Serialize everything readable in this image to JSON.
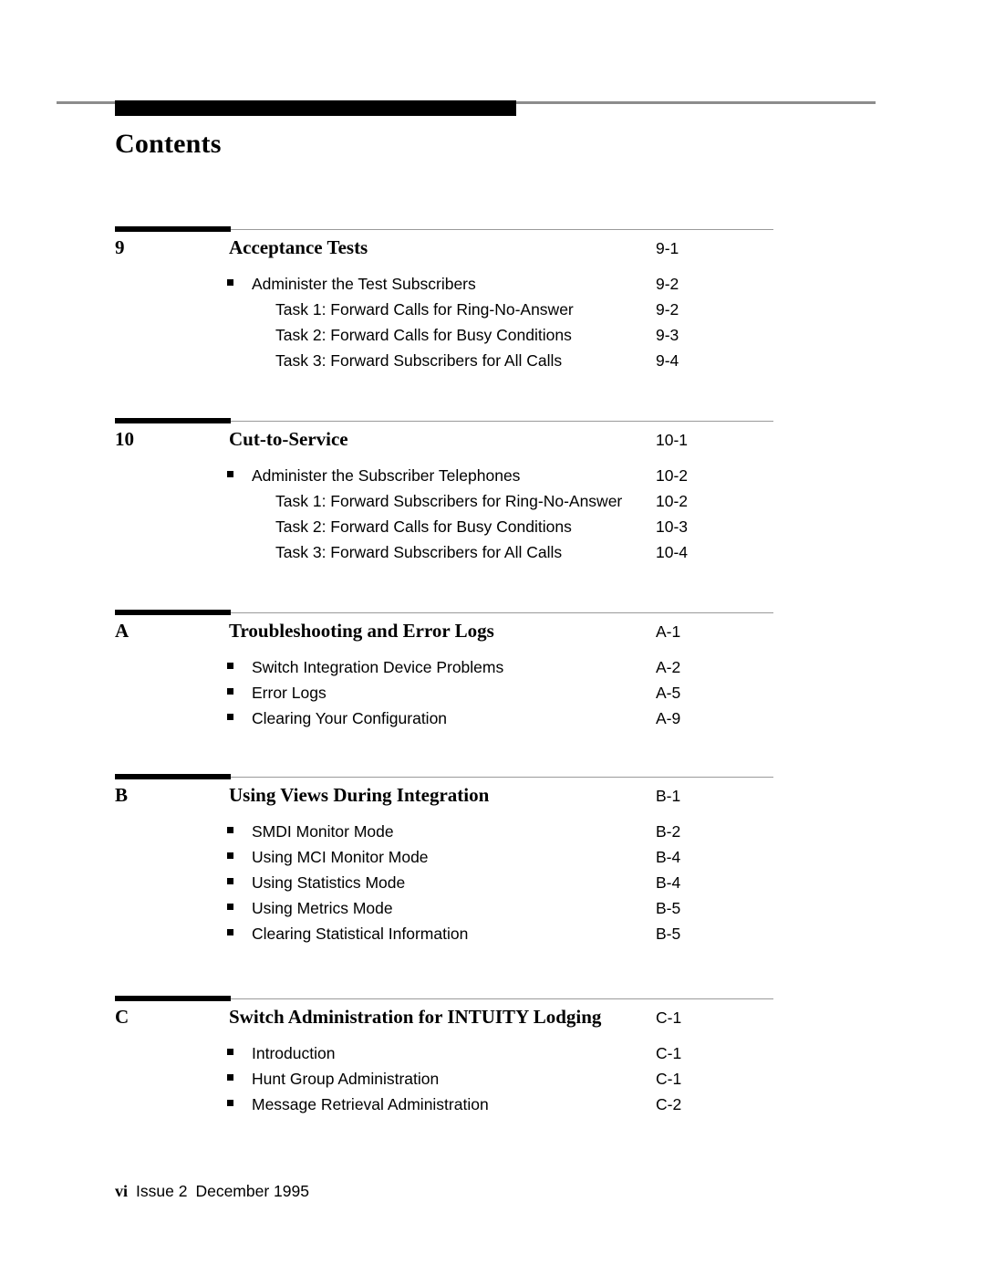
{
  "document": {
    "page_title": "Contents",
    "footer": {
      "folio": "vi",
      "issue": "Issue  2",
      "date": "December 1995"
    }
  },
  "colors": {
    "text": "#000000",
    "rule_gray": "#9a9a9a",
    "bar_black": "#000000",
    "page_background": "#ffffff"
  },
  "sections": [
    {
      "number": "9",
      "title": "Acceptance Tests",
      "page": "9-1",
      "entries": [
        {
          "level": 1,
          "label": "Administer the Test Subscribers",
          "page": "9-2"
        },
        {
          "level": 2,
          "label": "Task 1:  Forward Calls for Ring-No-Answer",
          "page": "9-2"
        },
        {
          "level": 2,
          "label": "Task 2:  Forward Calls for Busy Conditions",
          "page": "9-3"
        },
        {
          "level": 2,
          "label": "Task 3:  Forward Subscribers for All Calls",
          "page": "9-4"
        }
      ]
    },
    {
      "number": "10",
      "title": "Cut-to-Service",
      "page": "10-1",
      "entries": [
        {
          "level": 1,
          "label": "Administer the Subscriber Telephones",
          "page": "10-2"
        },
        {
          "level": 2,
          "label": "Task 1:  Forward Subscribers for Ring-No-Answer",
          "page": "10-2"
        },
        {
          "level": 2,
          "label": "Task 2:  Forward Calls for Busy Conditions",
          "page": "10-3"
        },
        {
          "level": 2,
          "label": "Task 3:  Forward Subscribers for All Calls",
          "page": "10-4"
        }
      ]
    },
    {
      "number": "A",
      "title": "Troubleshooting and Error Logs",
      "page": "A-1",
      "entries": [
        {
          "level": 1,
          "label": "Switch Integration Device Problems",
          "page": "A-2"
        },
        {
          "level": 1,
          "label": "Error Logs",
          "page": "A-5"
        },
        {
          "level": 1,
          "label": "Clearing Your Configuration",
          "page": "A-9"
        }
      ]
    },
    {
      "number": "B",
      "title": "Using Views During Integration",
      "page": "B-1",
      "entries": [
        {
          "level": 1,
          "label": "SMDI Monitor Mode",
          "page": "B-2"
        },
        {
          "level": 1,
          "label": "Using MCI Monitor Mode",
          "page": "B-4"
        },
        {
          "level": 1,
          "label": "Using Statistics Mode",
          "page": "B-4"
        },
        {
          "level": 1,
          "label": "Using Metrics Mode",
          "page": "B-5"
        },
        {
          "level": 1,
          "label": "Clearing Statistical Information",
          "page": "B-5"
        }
      ]
    },
    {
      "number": "C",
      "title": "Switch Administration for INTUITY Lodging",
      "page": "C-1",
      "entries": [
        {
          "level": 1,
          "label": "Introduction",
          "page": "C-1"
        },
        {
          "level": 1,
          "label": "Hunt Group Administration",
          "page": "C-1"
        },
        {
          "level": 1,
          "label": "Message Retrieval Administration",
          "page": "C-2"
        }
      ]
    }
  ],
  "layout": {
    "section_tops": [
      247,
      457,
      667,
      847,
      1090
    ]
  }
}
